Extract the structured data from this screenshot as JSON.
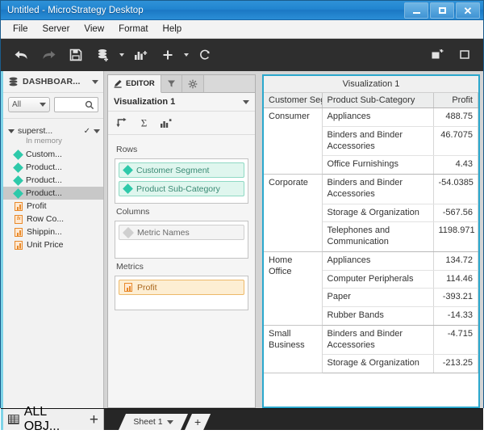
{
  "window": {
    "title": "Untitled - MicroStrategy Desktop",
    "controls": {
      "minimize": "–",
      "maximize": "□",
      "close": "✕"
    }
  },
  "menubar": {
    "items": [
      {
        "label": "File"
      },
      {
        "label": "Server"
      },
      {
        "label": "View"
      },
      {
        "label": "Format"
      },
      {
        "label": "Help"
      }
    ]
  },
  "toolbar": {
    "buttons": [
      {
        "name": "undo-icon",
        "enabled": true
      },
      {
        "name": "redo-icon",
        "enabled": false
      },
      {
        "name": "save-icon",
        "enabled": true
      },
      {
        "name": "add-data-icon",
        "enabled": true,
        "caret": true
      },
      {
        "name": "add-visualization-icon",
        "enabled": true
      },
      {
        "name": "add-object-icon",
        "enabled": true,
        "caret": true
      },
      {
        "name": "refresh-icon",
        "enabled": true
      }
    ],
    "right_buttons": [
      {
        "name": "add-panel-icon"
      },
      {
        "name": "presentation-icon"
      }
    ]
  },
  "sidebar": {
    "header": {
      "label": "DASHBOAR...",
      "icon": "dataset-icon"
    },
    "filter": {
      "selected": "All"
    },
    "search": {
      "placeholder": "",
      "value": ""
    },
    "dataset": {
      "name": "superst...",
      "status": "In memory",
      "certified": true
    },
    "objects": [
      {
        "label": "Custom...",
        "type": "attribute",
        "selected": false
      },
      {
        "label": "Product...",
        "type": "attribute",
        "selected": false
      },
      {
        "label": "Product...",
        "type": "attribute",
        "selected": false
      },
      {
        "label": "Product...",
        "type": "attribute",
        "selected": true
      },
      {
        "label": "Profit",
        "type": "metric",
        "selected": false
      },
      {
        "label": "Row Co...",
        "type": "derived-metric",
        "selected": false
      },
      {
        "label": "Shippin...",
        "type": "metric",
        "selected": false
      },
      {
        "label": "Unit Price",
        "type": "metric",
        "selected": false
      }
    ],
    "footer": {
      "label": "ALL OBJ...",
      "add": "+"
    }
  },
  "editor": {
    "tabs": [
      {
        "label": "EDITOR",
        "icon": "pencil-icon",
        "active": true
      },
      {
        "label": "",
        "icon": "filter-icon",
        "active": false
      },
      {
        "label": "",
        "icon": "gear-icon",
        "active": false
      }
    ],
    "visualization_selector": "Visualization 1",
    "action_icons": [
      {
        "name": "swap-rows-columns-icon"
      },
      {
        "name": "totals-sigma-icon"
      },
      {
        "name": "visualization-type-icon"
      }
    ],
    "shelves": [
      {
        "label": "Rows",
        "items": [
          {
            "label": "Customer Segment",
            "type": "attribute"
          },
          {
            "label": "Product Sub-Category",
            "type": "attribute"
          }
        ]
      },
      {
        "label": "Columns",
        "items": [
          {
            "label": "Metric Names",
            "type": "names"
          }
        ]
      },
      {
        "label": "Metrics",
        "items": [
          {
            "label": "Profit",
            "type": "metric"
          }
        ]
      }
    ]
  },
  "visualization": {
    "title": "Visualization 1",
    "grid": {
      "columns": [
        {
          "label": "Customer Seg",
          "align": "left"
        },
        {
          "label": "Product Sub-Category",
          "align": "left"
        },
        {
          "label": "Profit",
          "align": "right"
        }
      ],
      "rows": [
        {
          "segment": "Consumer",
          "subcategory": "Appliances",
          "profit": "488.75",
          "group_start": true,
          "group_end": false
        },
        {
          "segment": "",
          "subcategory": "Binders and Binder Accessories",
          "profit": "46.7075",
          "group_start": false,
          "group_end": false
        },
        {
          "segment": "",
          "subcategory": "Office Furnishings",
          "profit": "4.43",
          "group_start": false,
          "group_end": true
        },
        {
          "segment": "Corporate",
          "subcategory": "Binders and Binder Accessories",
          "profit": "-54.0385",
          "group_start": true,
          "group_end": false
        },
        {
          "segment": "",
          "subcategory": "Storage & Organization",
          "profit": "-567.56",
          "group_start": false,
          "group_end": false
        },
        {
          "segment": "",
          "subcategory": "Telephones and Communication",
          "profit": "1198.971",
          "group_start": false,
          "group_end": true
        },
        {
          "segment": "Home Office",
          "subcategory": "Appliances",
          "profit": "134.72",
          "group_start": true,
          "group_end": false
        },
        {
          "segment": "",
          "subcategory": "Computer Peripherals",
          "profit": "114.46",
          "group_start": false,
          "group_end": false
        },
        {
          "segment": "",
          "subcategory": "Paper",
          "profit": "-393.21",
          "group_start": false,
          "group_end": false
        },
        {
          "segment": "",
          "subcategory": "Rubber Bands",
          "profit": "-14.33",
          "group_start": false,
          "group_end": true
        },
        {
          "segment": "Small Business",
          "subcategory": "Binders and Binder Accessories",
          "profit": "-4.715",
          "group_start": true,
          "group_end": false
        },
        {
          "segment": "",
          "subcategory": "Storage & Organization",
          "profit": "-213.25",
          "group_start": false,
          "group_end": true
        }
      ]
    }
  },
  "sheets": {
    "tabs": [
      {
        "label": "Sheet 1",
        "active": true
      }
    ],
    "add_label": "+"
  },
  "colors": {
    "titlebar_blue": "#2185d0",
    "toolbar_dark": "#2e2e2e",
    "viz_border_teal": "#2ba8cd",
    "attribute_green": "#2ec9aa",
    "metric_orange": "#e8892a",
    "selection_grey": "#c8c8c8"
  }
}
